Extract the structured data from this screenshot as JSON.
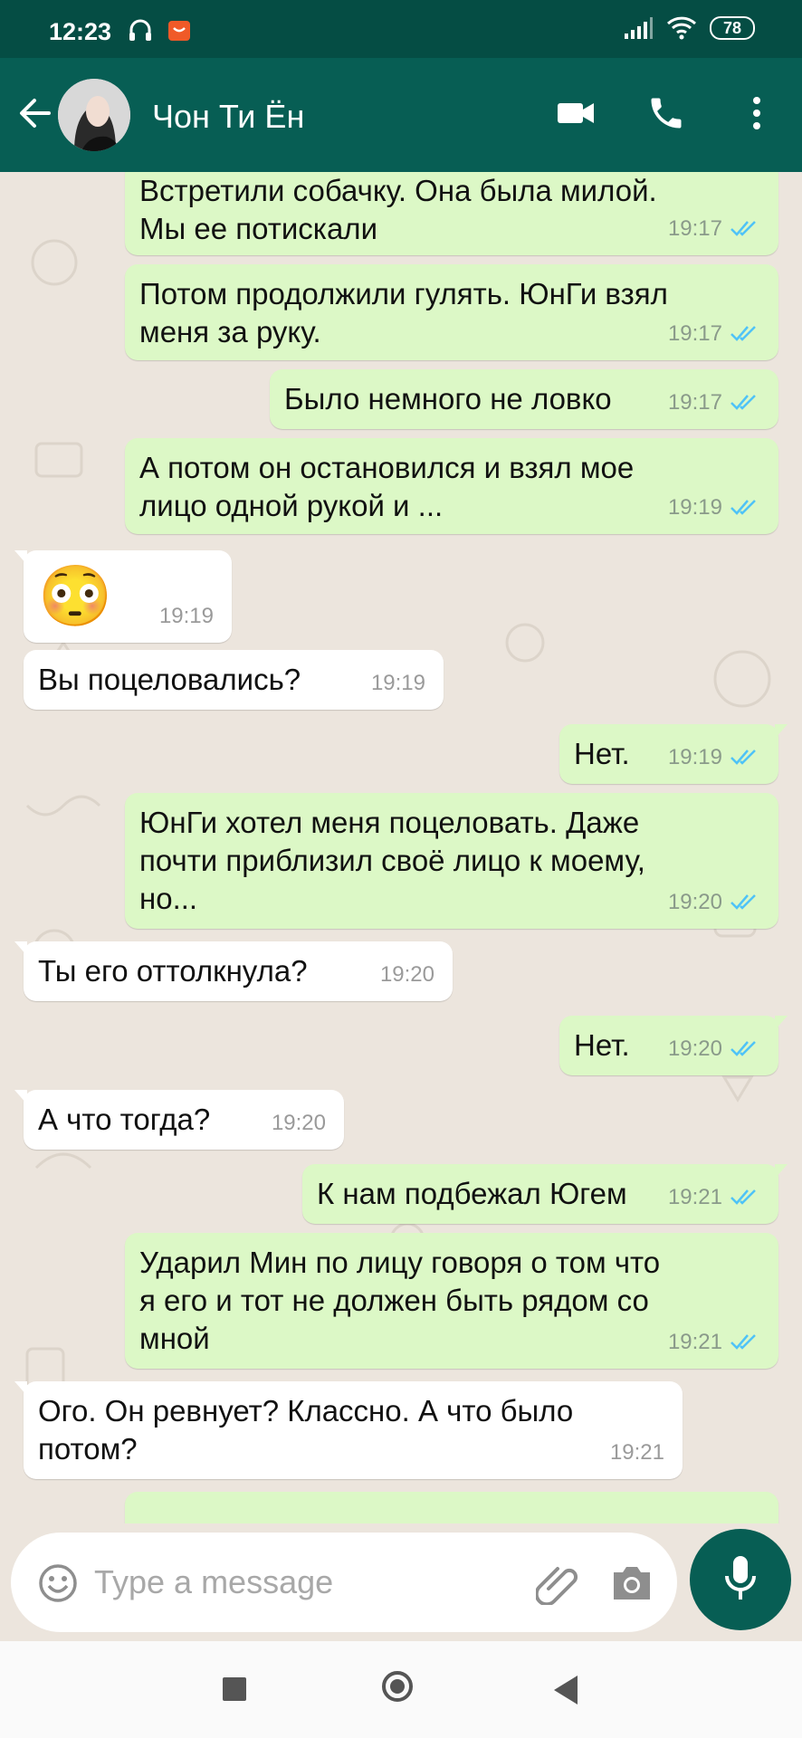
{
  "status_bar": {
    "time": "12:23",
    "battery": "78"
  },
  "header": {
    "contact_name": "Чон Ти Ён"
  },
  "messages": [
    {
      "dir": "out",
      "text": "Встретили собачку. Она была милой.\nМы ее потискали",
      "time": "19:17",
      "read": true
    },
    {
      "dir": "out",
      "text": "Потом продолжили гулять. ЮнГи взял\nменя за руку.",
      "time": "19:17",
      "read": true
    },
    {
      "dir": "out",
      "text": "Было немного не ловко",
      "time": "19:17",
      "read": true
    },
    {
      "dir": "out",
      "text": "А потом он остановился и взял мое\nлицо одной рукой и ...",
      "time": "19:19",
      "read": true
    },
    {
      "dir": "in",
      "text": "😳",
      "time": "19:19"
    },
    {
      "dir": "in",
      "text": "Вы поцеловались?",
      "time": "19:19"
    },
    {
      "dir": "out",
      "text": "Нет.",
      "time": "19:19",
      "read": true
    },
    {
      "dir": "out",
      "text": "ЮнГи хотел меня поцеловать. Даже\nпочти приблизил своё лицо к моему,\nно...",
      "time": "19:20",
      "read": true
    },
    {
      "dir": "in",
      "text": "Ты его оттолкнула?",
      "time": "19:20"
    },
    {
      "dir": "out",
      "text": "Нет.",
      "time": "19:20",
      "read": true
    },
    {
      "dir": "in",
      "text": "А что тогда?",
      "time": "19:20"
    },
    {
      "dir": "out",
      "text": "К нам подбежал Югем",
      "time": "19:21",
      "read": true
    },
    {
      "dir": "out",
      "text": "Ударил Мин по лицу говоря о том что\nя его и тот не должен быть рядом со\nмной",
      "time": "19:21",
      "read": true
    },
    {
      "dir": "in",
      "text": "Ого. Он ревнует? Классно. А что было\nпотом?",
      "time": "19:21"
    }
  ],
  "input": {
    "placeholder": "Type a message"
  },
  "colors": {
    "header": "#075E54",
    "status_bar": "#054D44",
    "outgoing_bubble": "#DCF8C6",
    "incoming_bubble": "#FFFFFF",
    "read_ticks": "#4FC3F7",
    "chat_bg": "#ECE5DD"
  },
  "icons": [
    "back-arrow-icon",
    "video-call-icon",
    "phone-icon",
    "more-options-icon",
    "emoji-icon",
    "attach-icon",
    "camera-icon",
    "mic-icon",
    "headphones-icon",
    "notification-app-icon",
    "signal-icon",
    "wifi-icon"
  ]
}
